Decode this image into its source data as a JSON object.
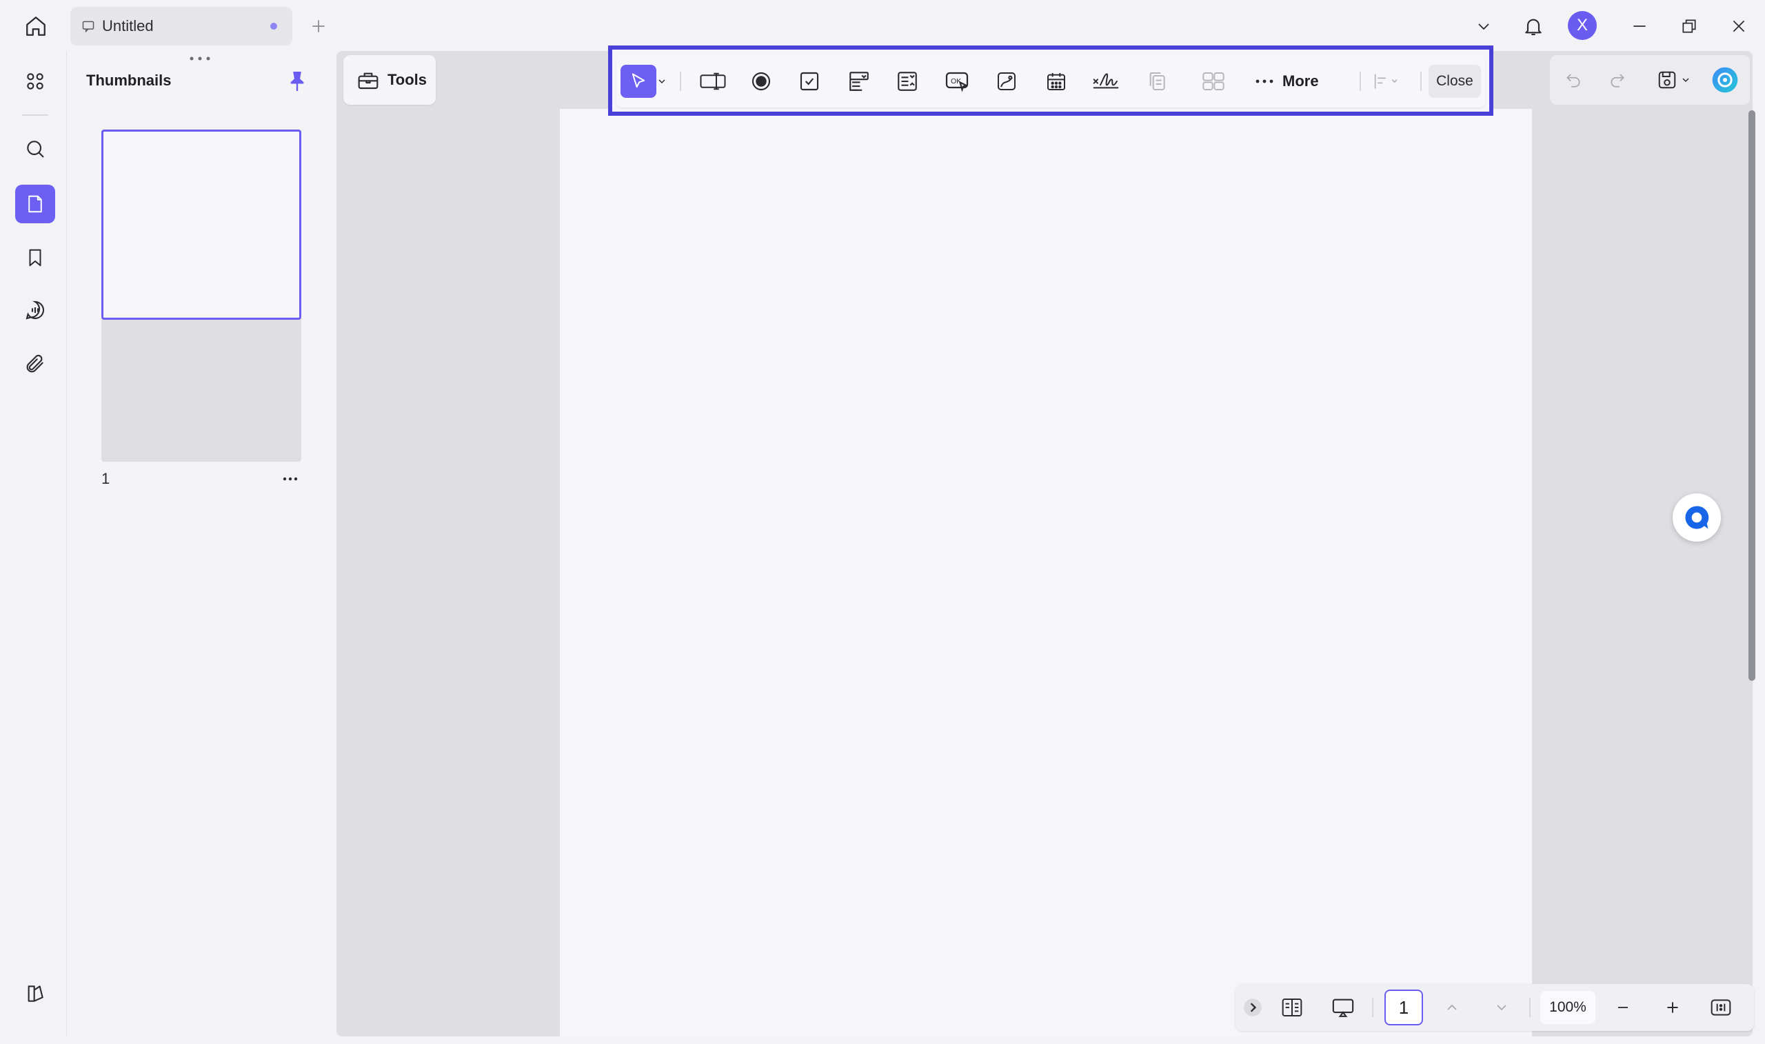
{
  "tab": {
    "title": "Untitled"
  },
  "icons": {
    "home": "home-icon",
    "new_tab": "plus-icon",
    "notifications": "bell-icon",
    "avatar_letter_color": "#6a5cf0"
  },
  "user": {
    "avatar_letter": "X"
  },
  "thumbnails_panel": {
    "title": "Thumbnails",
    "pages": [
      {
        "number": "1"
      }
    ]
  },
  "tools_button": {
    "label": "Tools"
  },
  "form_toolbar": {
    "more_label": "More",
    "close_label": "Close",
    "highlight_color": "#4a3fd6"
  },
  "page_nav": {
    "current_page": "1",
    "zoom": "100%"
  },
  "colors": {
    "accent": "#6d5ff2",
    "workspace": "#dfdfe3",
    "page": "#f6f6f9"
  }
}
